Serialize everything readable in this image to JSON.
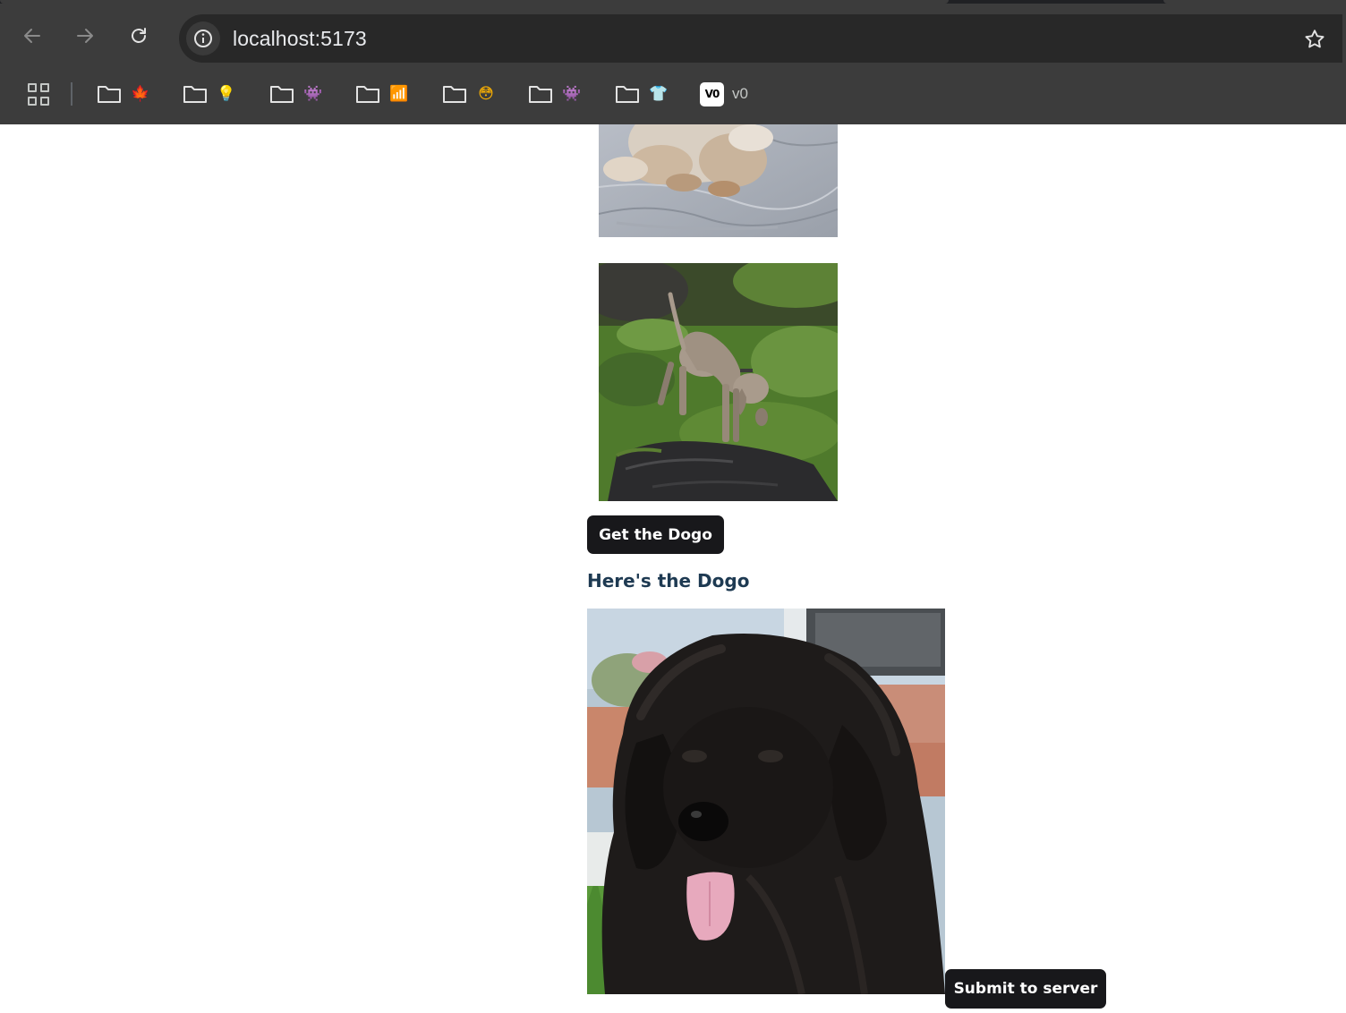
{
  "browser": {
    "url": "localhost:5173",
    "bookmarks": [
      {
        "type": "folder",
        "emoji": "🍁"
      },
      {
        "type": "folder",
        "emoji": "💡"
      },
      {
        "type": "folder",
        "emoji": "👾"
      },
      {
        "type": "folder",
        "emoji": "📶"
      },
      {
        "type": "folder",
        "emoji": "😳"
      },
      {
        "type": "folder",
        "emoji": "👾"
      },
      {
        "type": "folder",
        "emoji": "👕"
      },
      {
        "type": "link",
        "logo": "V0",
        "label": "v0"
      }
    ],
    "icons": [
      "back-arrow-icon",
      "forward-arrow-icon",
      "reload-icon",
      "info-icon",
      "star-icon",
      "apps-grid-icon",
      "folder-icon"
    ]
  },
  "page": {
    "images": [
      {
        "subject": "puppy-on-blanket"
      },
      {
        "subject": "weimaraner-on-rock"
      },
      {
        "subject": "newfoundland-dog"
      }
    ],
    "get_button_label": "Get the Dogo",
    "result_heading": "Here's the Dogo",
    "submit_button_label": "Submit to server"
  },
  "colors": {
    "chrome_bg": "#3c3c3c",
    "omnibox_bg": "#282828",
    "button_bg": "#18181b",
    "heading_color": "#1e3a52"
  }
}
